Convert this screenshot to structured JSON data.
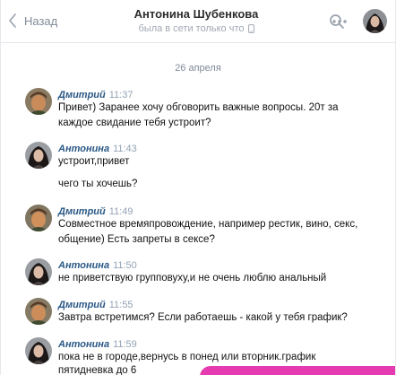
{
  "header": {
    "back_label": "Назад",
    "name": "Антонина Шубенкова",
    "status": "была в сети только что"
  },
  "date_divider": "26 апреля",
  "messages": [
    {
      "author": "Дмитрий",
      "time": "11:37",
      "lines": [
        "Привет) Заранее хочу обговорить важные вопросы. 20т за",
        "каждое свидание тебя устроит?"
      ]
    },
    {
      "author": "Антонина",
      "time": "11:43",
      "lines": [
        "устроит,привет",
        "",
        "чего ты хочешь?"
      ]
    },
    {
      "author": "Дмитрий",
      "time": "11:49",
      "lines": [
        "Совместное времяпровождение, например рестик, вино, секс,",
        "общение) Есть запреты в сексе?"
      ]
    },
    {
      "author": "Антонина",
      "time": "11:50",
      "lines": [
        "не приветствую групповуху,и не очень люблю анальный"
      ]
    },
    {
      "author": "Дмитрий",
      "time": "11:55",
      "lines": [
        "Завтра встретимся? Если работаешь - какой у тебя график?"
      ]
    },
    {
      "author": "Антонина",
      "time": "11:59",
      "lines": [
        "пока не в городе,вернусь в понед или вторник.график",
        "пятидневка до 6"
      ]
    }
  ],
  "colors": {
    "author_link": "#2a5885",
    "time": "#93a3b5",
    "muted": "#818c99",
    "accent_bar": "#e63ab0"
  },
  "icons": [
    "chevron-left-icon",
    "phone-icon",
    "search-icon",
    "more-icon"
  ]
}
